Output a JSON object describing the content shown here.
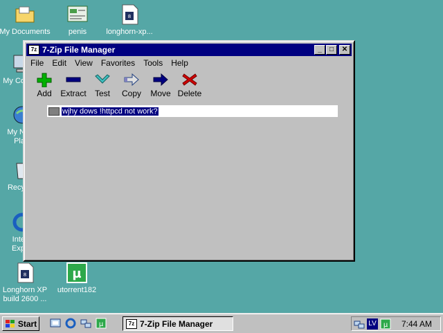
{
  "desktop": {
    "icons": [
      {
        "label": "My Documents"
      },
      {
        "label": "penis"
      },
      {
        "label": "longhorn-xp..."
      },
      {
        "label": "My Co"
      },
      {
        "label": "My N"
      },
      {
        "label": "Pla"
      },
      {
        "label": "Recy"
      },
      {
        "label": "Inte"
      },
      {
        "label": "Exp"
      },
      {
        "label": "Longhorn XP"
      },
      {
        "label": "build 2600 ..."
      },
      {
        "label": "utorrent182"
      }
    ]
  },
  "window": {
    "title": "7-Zip File Manager",
    "app_icon": "7z",
    "controls": {
      "minimize": "_",
      "maximize": "□",
      "close": "✕"
    },
    "menu": [
      "File",
      "Edit",
      "View",
      "Favorites",
      "Tools",
      "Help"
    ],
    "toolbar": [
      {
        "label": "Add",
        "icon": "plus-icon"
      },
      {
        "label": "Extract",
        "icon": "minus-icon"
      },
      {
        "label": "Test",
        "icon": "check-icon"
      },
      {
        "label": "Copy",
        "icon": "copy-arrow-icon"
      },
      {
        "label": "Move",
        "icon": "move-arrow-icon"
      },
      {
        "label": "Delete",
        "icon": "delete-x-icon"
      }
    ],
    "list": {
      "editing_item": "wjhy dows !httpcd not work?"
    }
  },
  "taskbar": {
    "start_label": "Start",
    "task_title": "7-Zip File Manager",
    "tray_lang": "LV",
    "clock": "7:44 AM"
  },
  "colors": {
    "desktop": "#55a7a6",
    "title_active": "#000080",
    "face": "#c0c0c0",
    "add": "#00b000",
    "extract": "#000080",
    "test": "#40c0c0",
    "delete": "#d00000"
  }
}
